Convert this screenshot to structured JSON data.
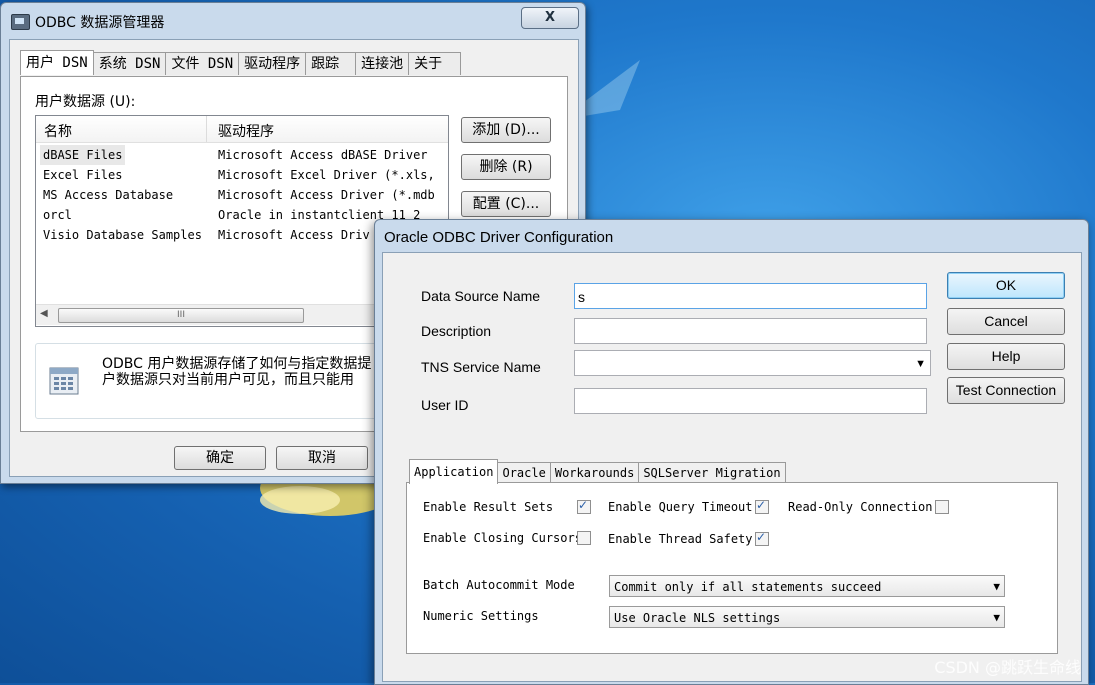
{
  "main_window": {
    "title": "ODBC 数据源管理器",
    "close_label": "X",
    "tabs": [
      {
        "label": "用户 DSN"
      },
      {
        "label": "系统 DSN"
      },
      {
        "label": "文件 DSN"
      },
      {
        "label": "驱动程序"
      },
      {
        "label": "跟踪"
      },
      {
        "label": "连接池"
      },
      {
        "label": "关于"
      }
    ],
    "section_label": "用户数据源 (U):",
    "columns": [
      "名称",
      "驱动程序"
    ],
    "rows": [
      {
        "name": "dBASE Files",
        "driver": "Microsoft Access dBASE Driver"
      },
      {
        "name": "Excel Files",
        "driver": "Microsoft Excel Driver (*.xls,"
      },
      {
        "name": "MS Access Database",
        "driver": "Microsoft Access Driver (*.mdb"
      },
      {
        "name": "orcl",
        "driver": "Oracle in instantclient_11_2"
      },
      {
        "name": "Visio Database Samples",
        "driver": "Microsoft Access Driv"
      }
    ],
    "scroll_grip": "III",
    "buttons": {
      "add": "添加 (D)...",
      "remove": "删除 (R)",
      "configure": "配置 (C)..."
    },
    "info_lines": [
      "ODBC 用户数据源存储了如何与指定数据提",
      "户数据源只对当前用户可见，而且只能用"
    ],
    "ok": "确定",
    "cancel": "取消"
  },
  "oracle_dialog": {
    "title": "Oracle ODBC Driver Configuration",
    "fields": {
      "dsn_label": "Data Source Name",
      "dsn_value": "s",
      "desc_label": "Description",
      "desc_value": "",
      "tns_label": "TNS Service Name",
      "tns_value": "",
      "userid_label": "User ID",
      "userid_value": ""
    },
    "buttons": {
      "ok": "OK",
      "cancel": "Cancel",
      "help": "Help",
      "test": "Test Connection"
    },
    "tabs": [
      "Application",
      "Oracle",
      "Workarounds",
      "SQLServer Migration"
    ],
    "options": {
      "result_sets": {
        "label": "Enable Result Sets",
        "checked": true
      },
      "query_timeout": {
        "label": "Enable Query Timeout",
        "checked": true
      },
      "read_only": {
        "label": "Read-Only Connection",
        "checked": false
      },
      "closing_cursors": {
        "label": "Enable Closing Cursors",
        "checked": false
      },
      "thread_safety": {
        "label": "Enable Thread Safety",
        "checked": true
      }
    },
    "batch_label": "Batch Autocommit Mode",
    "batch_value": "Commit only if all statements succeed",
    "numeric_label": "Numeric Settings",
    "numeric_value": "Use Oracle NLS settings"
  },
  "watermark": "CSDN @跳跃生命线"
}
